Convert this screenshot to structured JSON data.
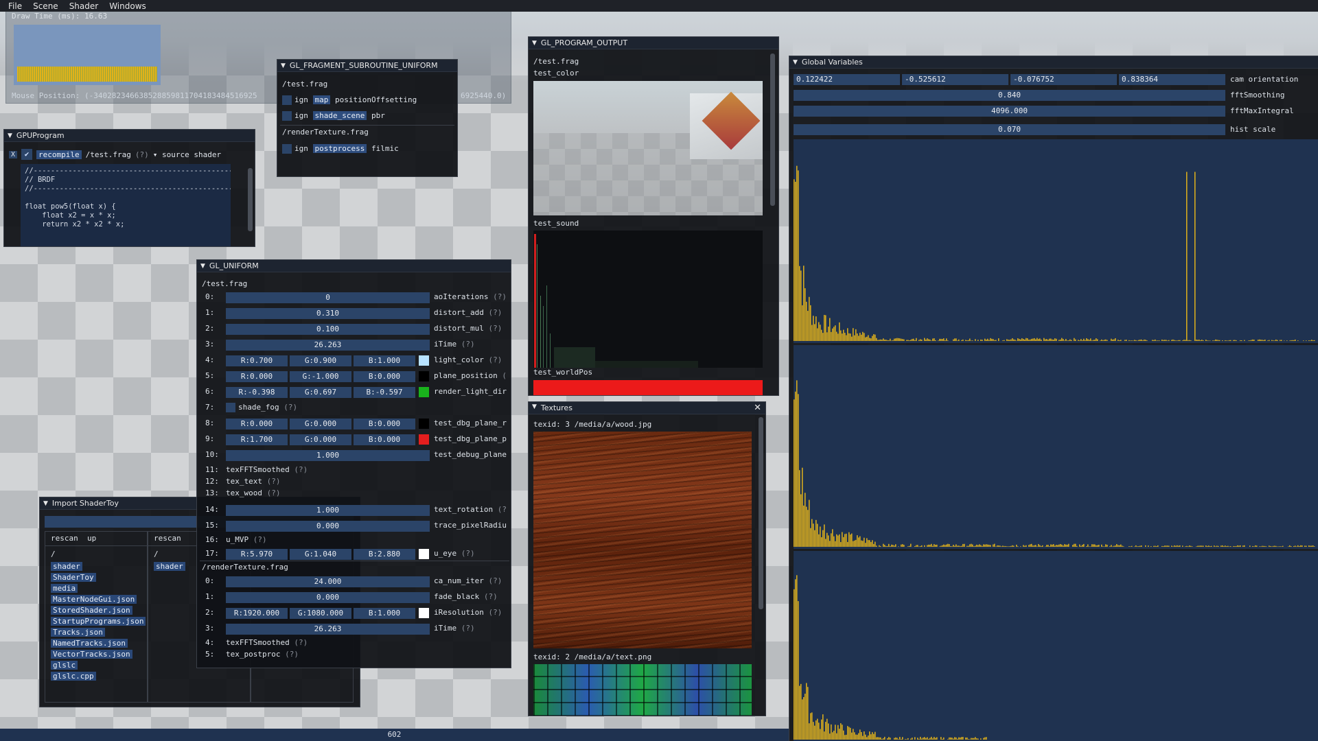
{
  "menu": [
    "File",
    "Scene",
    "Shader",
    "Windows"
  ],
  "overlay": {
    "draw_time": "Draw Time (ms): 16.63",
    "mouse_position": "Mouse Position: (-340282346638528859811704183484516925",
    "mouse_position_tail": "6925440.0)"
  },
  "gpu_program": {
    "title": "GPUProgram",
    "x_label": "X",
    "recompile": "recompile",
    "file": "/test.frag",
    "help": "(?)",
    "source": "source shader",
    "code": [
      "//-----------------------------------------------------",
      "// BRDF",
      "//-----------------------------------------------------",
      "",
      "float pow5(float x) {",
      "    float x2 = x * x;",
      "    return x2 * x2 * x;"
    ]
  },
  "subroutine": {
    "title": "GL_FRAGMENT_SUBROUTINE_UNIFORM",
    "file1": "/test.frag",
    "rows1": [
      {
        "ign": "ign",
        "name": "map",
        "val": "positionOffsetting"
      },
      {
        "ign": "ign",
        "name": "shade_scene",
        "val": "pbr"
      }
    ],
    "file2": "/renderTexture.frag",
    "rows2": [
      {
        "ign": "ign",
        "name": "postprocess",
        "val": "filmic"
      }
    ]
  },
  "uniform": {
    "title": "GL_UNIFORM",
    "file1": "/test.frag",
    "file2": "/renderTexture.frag",
    "rows": [
      {
        "i": "0:",
        "v": "0",
        "n": "aoIterations",
        "h": "(?)"
      },
      {
        "i": "1:",
        "v": "0.310",
        "n": "distort_add",
        "h": "(?)"
      },
      {
        "i": "2:",
        "v": "0.100",
        "n": "distort_mul",
        "h": "(?)"
      },
      {
        "i": "3:",
        "v": "26.263",
        "n": "iTime",
        "h": "(?)"
      },
      {
        "i": "4:",
        "r": "R:0.700",
        "g": "G:0.900",
        "b": "B:1.000",
        "c": "#b7e2ff",
        "n": "light_color",
        "h": "(?)"
      },
      {
        "i": "5:",
        "r": "R:0.000",
        "g": "G:-1.000",
        "b": "B:0.000",
        "c": "#000000",
        "n": "plane_position",
        "h": "("
      },
      {
        "i": "6:",
        "r": "R:-0.398",
        "g": "G:0.697",
        "b": "B:-0.597",
        "c": "#19b21c",
        "n": "render_light_dir",
        "h": ""
      },
      {
        "i": "7:",
        "chk": "shade_fog",
        "h": "(?)"
      },
      {
        "i": "8:",
        "r": "R:0.000",
        "g": "G:0.000",
        "b": "B:0.000",
        "c": "#000000",
        "n": "test_dbg_plane_r",
        "h": ""
      },
      {
        "i": "9:",
        "r": "R:1.700",
        "g": "G:0.000",
        "b": "B:0.000",
        "c": "#e41e1e",
        "n": "test_dbg_plane_p",
        "h": ""
      },
      {
        "i": "10:",
        "v": "1.000",
        "n": "test_debug_plane",
        "h": ""
      },
      {
        "i": "11:",
        "t": "texFFTSmoothed",
        "h": "(?)"
      },
      {
        "i": "12:",
        "t": "tex_text",
        "h": "(?)"
      },
      {
        "i": "13:",
        "t": "tex_wood",
        "h": "(?)"
      },
      {
        "i": "14:",
        "v": "1.000",
        "n": "text_rotation",
        "h": "(?"
      },
      {
        "i": "15:",
        "v": "0.000",
        "n": "trace_pixelRadiu",
        "h": ""
      },
      {
        "i": "16:",
        "t": "u_MVP",
        "h": "(?)"
      },
      {
        "i": "17:",
        "r": "R:5.970",
        "g": "G:1.040",
        "b": "B:2.880",
        "c": "#ffffff",
        "n": "u_eye",
        "h": "(?)"
      }
    ],
    "rows2": [
      {
        "i": "0:",
        "v": "24.000",
        "n": "ca_num_iter",
        "h": "(?)"
      },
      {
        "i": "1:",
        "v": "0.000",
        "n": "fade_black",
        "h": "(?)"
      },
      {
        "i": "2:",
        "r": "R:1920.000",
        "g": "G:1080.000",
        "b": "B:1.000",
        "c": "#ffffff",
        "n": "iResolution",
        "h": "(?)"
      },
      {
        "i": "3:",
        "v": "26.263",
        "n": "iTime",
        "h": "(?)"
      },
      {
        "i": "4:",
        "t": "texFFTSmoothed",
        "h": "(?)"
      },
      {
        "i": "5:",
        "t": "tex_postproc",
        "h": "(?)"
      }
    ]
  },
  "import": {
    "title": "Import ShaderToy",
    "rescan": "rescan",
    "up": "up",
    "rescan2": "rescan",
    "root": "/",
    "root2": "/",
    "shader2": "shader",
    "items": [
      "shader",
      "ShaderToy",
      "media",
      "MasterNodeGui.json",
      "StoredShader.json",
      "StartupPrograms.json",
      "Tracks.json",
      "NamedTracks.json",
      "VectorTracks.json",
      "glslc",
      "glslc.cpp"
    ]
  },
  "program_output": {
    "title": "GL_PROGRAM_OUTPUT",
    "file": "/test.frag",
    "labels": [
      "test_color",
      "test_sound",
      "test_worldPos"
    ]
  },
  "textures": {
    "title": "Textures",
    "tex1": "texid: 3 /media/a/wood.jpg",
    "tex2": "texid: 2 /media/a/text.png"
  },
  "global": {
    "title": "Global Variables",
    "cam": [
      "0.122422",
      "-0.525612",
      "-0.076752",
      "0.838364"
    ],
    "cam_label": "cam orientation",
    "fftSmoothing": "0.840",
    "fftSmoothing_label": "fftSmoothing",
    "fftMaxIntegral": "4096.000",
    "fftMaxIntegral_label": "fftMaxIntegral",
    "hist": "0.070",
    "hist_label": "hist scale"
  },
  "status": {
    "value": "602"
  },
  "colors": {
    "accent": "#2e4d7e",
    "field": "#2b4468",
    "histogram": "#e2b21a",
    "hist_bg": "#1f3250"
  }
}
